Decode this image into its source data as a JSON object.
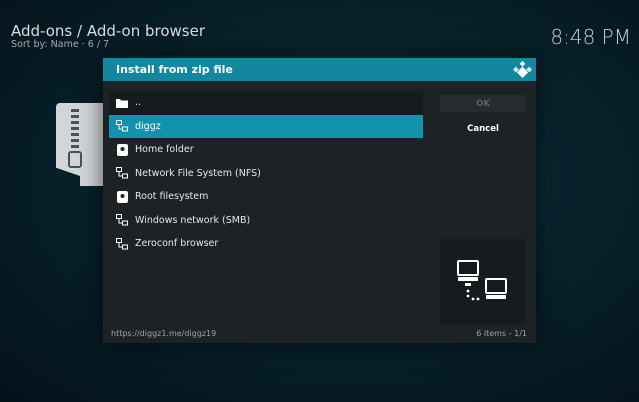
{
  "header": {
    "title": "Add-ons / Add-on browser",
    "sort": "Sort by: Name  ·  6 / 7",
    "clock": "8:48 PM"
  },
  "background": {
    "icon": "zip-file-icon"
  },
  "dialog": {
    "title": "Install from zip file",
    "logo_icon": "kodi-logo-icon",
    "items": [
      {
        "label": "..",
        "icon": "folder-icon"
      },
      {
        "label": "diggz",
        "icon": "network-icon",
        "selected": true
      },
      {
        "label": "Home folder",
        "icon": "drive-icon"
      },
      {
        "label": "Network File System (NFS)",
        "icon": "network-icon"
      },
      {
        "label": "Root filesystem",
        "icon": "drive-icon"
      },
      {
        "label": "Windows network (SMB)",
        "icon": "network-icon"
      },
      {
        "label": "Zeroconf browser",
        "icon": "network-icon"
      }
    ],
    "buttons": {
      "ok": "OK",
      "cancel": "Cancel"
    },
    "preview_icon": "network-computers-icon",
    "footer": {
      "path": "https://diggz1.me/diggz19",
      "count": "6 items - 1/1"
    }
  },
  "colors": {
    "accent": "#12879f",
    "selection": "#1292ae",
    "dialog_bg": "#1d2325"
  }
}
